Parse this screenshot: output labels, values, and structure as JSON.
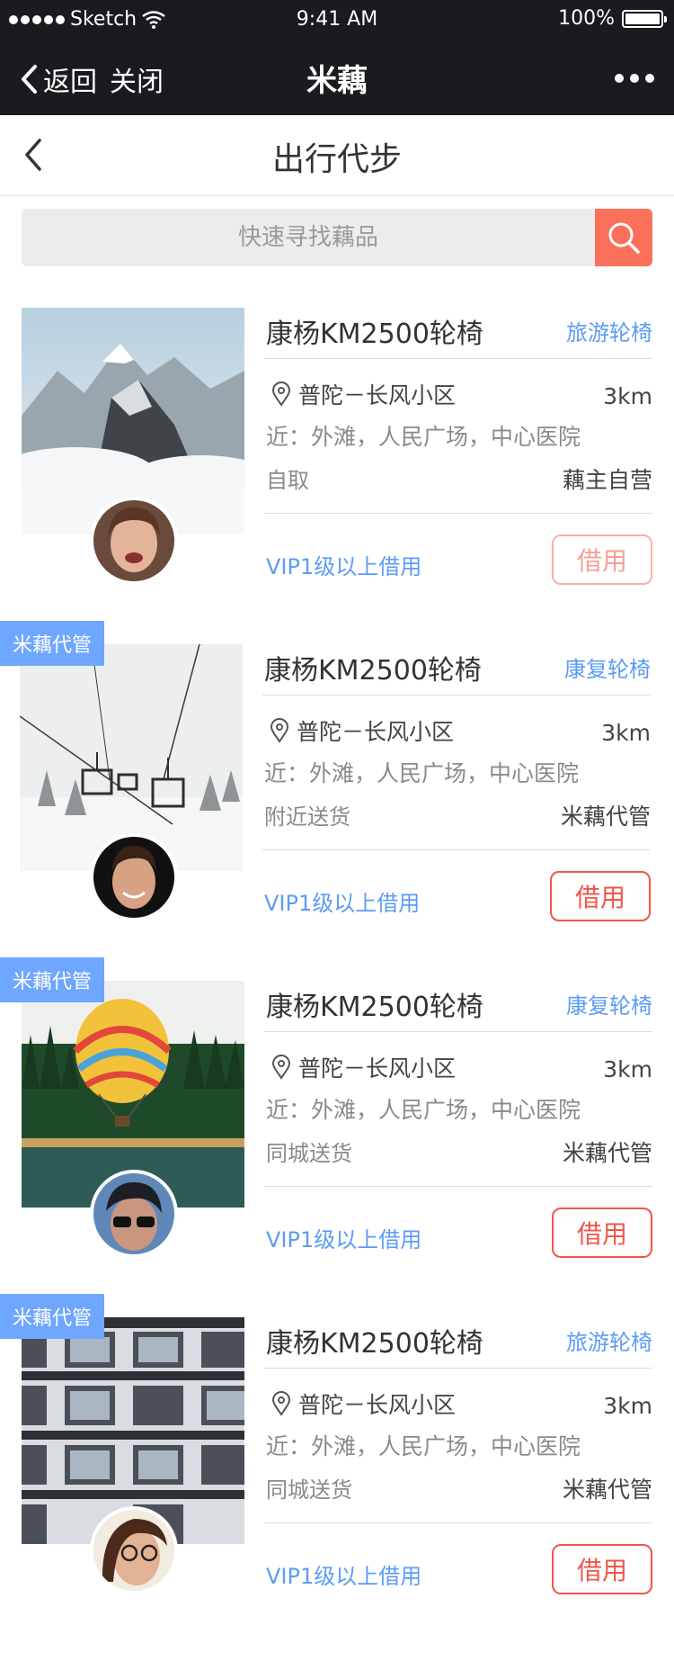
{
  "status_bar": {
    "carrier": "Sketch",
    "time": "9:41 AM",
    "battery": "100%"
  },
  "nav": {
    "back_label": "返回",
    "close_label": "关闭",
    "title": "米藕"
  },
  "page": {
    "title": "出行代步"
  },
  "search": {
    "placeholder": "快速寻找藕品"
  },
  "items": [
    {
      "name": "康杨KM2500轮椅",
      "tag": "旅游轮椅",
      "location": "普陀－长风小区",
      "distance": "3km",
      "nearby": "近：外滩，人民广场，中心医院",
      "delivery": "自取",
      "owner": "藕主自营",
      "requirement": "VIP1级以上借用",
      "action": "借用",
      "badge": ""
    },
    {
      "name": "康杨KM2500轮椅",
      "tag": "康复轮椅",
      "location": "普陀－长风小区",
      "distance": "3km",
      "nearby": "近：外滩，人民广场，中心医院",
      "delivery": "附近送货",
      "owner": "米藕代管",
      "requirement": "VIP1级以上借用",
      "action": "借用",
      "badge": "米藕代管"
    },
    {
      "name": "康杨KM2500轮椅",
      "tag": "康复轮椅",
      "location": "普陀－长风小区",
      "distance": "3km",
      "nearby": "近：外滩，人民广场，中心医院",
      "delivery": "同城送货",
      "owner": "米藕代管",
      "requirement": "VIP1级以上借用",
      "action": "借用",
      "badge": "米藕代管"
    },
    {
      "name": "康杨KM2500轮椅",
      "tag": "旅游轮椅",
      "location": "普陀－长风小区",
      "distance": "3km",
      "nearby": "近：外滩，人民广场，中心医院",
      "delivery": "同城送货",
      "owner": "米藕代管",
      "requirement": "VIP1级以上借用",
      "action": "借用",
      "badge": "米藕代管"
    }
  ],
  "colors": {
    "accent_blue": "#5b9cf5",
    "badge_blue": "#6fa6ff",
    "action_red": "#f0564a",
    "search_button": "#fb705a",
    "dark_bar": "#1b1b1f"
  }
}
